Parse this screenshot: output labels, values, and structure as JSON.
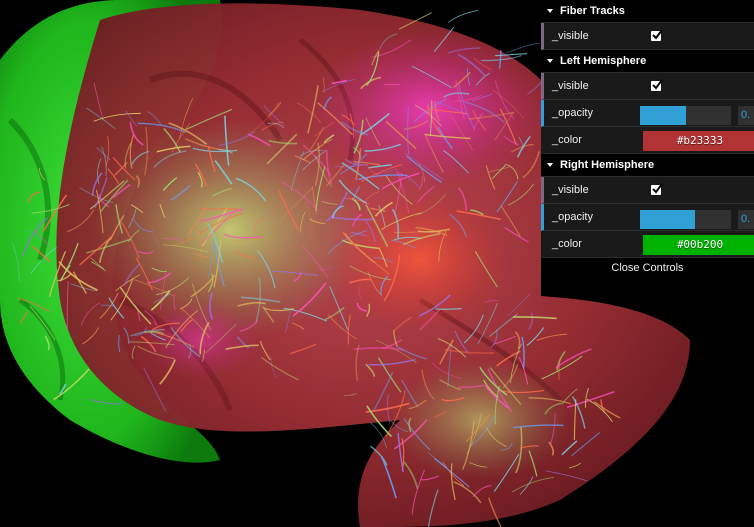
{
  "gui": {
    "folders": [
      {
        "title": "Fiber Tracks",
        "visible": {
          "label": "_visible",
          "checked": true
        }
      },
      {
        "title": "Left Hemisphere",
        "visible": {
          "label": "_visible",
          "checked": true
        },
        "opacity": {
          "label": "_opacity",
          "value_text": "0.",
          "fraction": 0.5
        },
        "color": {
          "label": "_color",
          "value": "#b23333"
        }
      },
      {
        "title": "Right Hemisphere",
        "visible": {
          "label": "_visible",
          "checked": true
        },
        "opacity": {
          "label": "_opacity",
          "value_text": "0.",
          "fraction": 0.6
        },
        "color": {
          "label": "_color",
          "value": "#00b200"
        }
      }
    ],
    "close_label": "Close Controls"
  },
  "colors": {
    "left_hemisphere": "#b23333",
    "right_hemisphere": "#00b200",
    "slider_accent": "#2fa1d6",
    "boolean_accent": "#806787"
  },
  "viewport": {
    "content": "brain-fiber-tract-render"
  }
}
